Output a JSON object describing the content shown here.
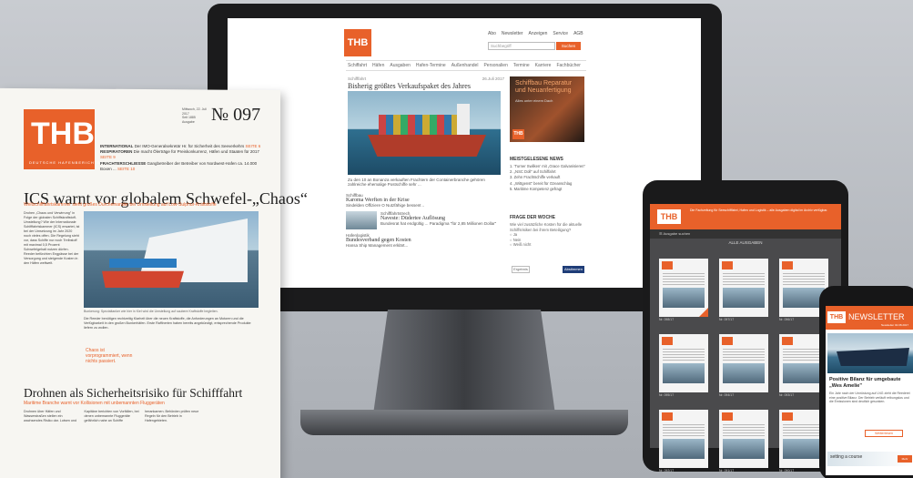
{
  "brand": {
    "accent": "#e8612a",
    "logo": "THB",
    "logo_sub": "DEUTSCHE HAFENBERICHTE"
  },
  "website": {
    "header_links": [
      "Abo",
      "Newsletter",
      "Anzeigen",
      "Service",
      "AGB"
    ],
    "search_placeholder": "Suchbegriff",
    "search_button": "Suchen",
    "nav": [
      "Schiffahrt",
      "Häfen",
      "Ausgaben",
      "Hafen-Termine",
      "Außenhandel",
      "Personalien",
      "Termine",
      "Karriere",
      "Fachbücher"
    ],
    "main_kicker": "Schifffahrt",
    "main_date": "26.Juli 2017",
    "main_title": "Bisherig größtes Verkaufspaket des Jahres",
    "main_caption": "Zu den 10 an Bonanza verkauften Frachtern der Containerbranche gehören zahlreiche ehemalige Postschiffe sehr ...",
    "ad_title": "Schiffbau Reparatur und Neuanfertigung",
    "ad_sub": "Alles unter einem Dach",
    "news_head": "MEISTGELESENE NEWS",
    "news_items": [
      "1. 'Turner Swilken' mit „Grace Galvanisieren\"",
      "2. „NSC Doll\" auf Schiffahrt",
      "3. Zehn Frachtschiffe verkauft",
      "4. „Wittgenst\" bereit für Ozeanschlag",
      "5. Maritime Kompetenz gefragt"
    ],
    "sub_kicker": "Schiffbau",
    "sub_title": "Karoma Werften in der Krise",
    "sub_text": "Sindelden Offiziere O Nutzfähige bessent ..",
    "list": [
      {
        "kicker": "Schifffahrtstrech",
        "title": "Naveste: Düdertee Auflösung",
        "text": "Bundesrat hat endgültig ... Paradigma \"für 2,85 Millionen Dollar\""
      },
      {
        "kicker": "Hafenlogistik",
        "title": "Bundesverband gegen Kosten",
        "text": "Hansa Ship Management erklärt..."
      }
    ],
    "poll_head": "FRAGE DER WOCHE",
    "poll_text": "Wie viel zusätzliche Kosten für die aktuelle Schiffsrisiken bei ihrem Beteiligung?",
    "poll_options": [
      "Ja",
      "Nein",
      "Weiß nicht"
    ],
    "poll_secondary_button": "Ergebnis",
    "poll_button": "Abstimmen"
  },
  "newspaper": {
    "issue_number": "№ 097",
    "date_lines": [
      "Mittwoch, 22. Juli 2017",
      "Seit 1885",
      "Ausgabe"
    ],
    "teasers": [
      {
        "label": "INTERNATIONAL",
        "text": "Der IMO-Generalsekretär Hr. für Sicherheit des Seeverkehrs",
        "ref": "SEITE 6"
      },
      {
        "label": "RESPIRATOREN",
        "text": "Die macht Ölerträge für Preiskonkurrenz, Häfen und Staaten für 2017",
        "ref": "SEITE 9"
      },
      {
        "label": "FRACHTERSCHLIESSE",
        "text": "Gangbetreiber der Betreiber von Nordwest-Hafen ca. 14.000 Boxen ...",
        "ref": "SEITE 10"
      }
    ],
    "headline": "ICS warnt vor globalem Schwefel-„Chaos“",
    "deck": "Weltschifffahrtskammer sieht großes Durcheinander bei Umstellung auf Low-Sulphur-Kraftstoffe",
    "column_text": "Drohen „Chaos und Verwirrung\" in Folge der globalen Schiffskraftstoff-Umstellung? Wie der Internationale Schifffahrtskammer (ICS) erwartet, ist bei der Umsetzung im Jahr 2020 noch vieles offen. Die Regelung sieht vor, dass Schiffe nur noch Treibstoff mit maximal 0,5 Prozent Schwefelgehalt nutzen dürfen. Reeder befürchten Engpässe bei der Versorgung und steigende Kosten in den Häfen weltweit.",
    "photo_caption": "Bunkerung: Spezialtanker wie hier in Kiel wird die Umstellung auf saubere Kraftstoffe begleiten.",
    "body_text": "Die Reeder benötigen rechtzeitig Klarheit über die neuen Kraftstoffe, die Anforderungen an Motoren und die Verfügbarkeit in den großen Bunkerhäfen. Erste Raffinerien haben bereits angekündigt, entsprechende Produkte liefern zu wollen.",
    "quote": "Chaos ist vorprogrammiert, wenn nichts passiert.",
    "headline2": "Drohnen als Sicherheitsrisiko für Schifffahrt",
    "deck2": "Maritime Branche warnt vor Kollisionen mit unbemannten Fluggeräten",
    "body2": "Drohnen über Häfen und Wasserstraßen stellen ein wachsendes Risiko dar. Lotsen und Kapitäne berichten von Vorfällen, bei denen unbemannte Fluggeräte gefährlich nahe an Schiffe herankamen. Behörden prüfen neue Regeln für den Betrieb in Hafengebieten."
  },
  "tablet": {
    "header_text": "Die Fachzeitung für Seeschifffahrt, Hafen und Logistik – alle Ausgaben digital im Archiv verfügbar.",
    "search_placeholder": "Ausgabe suchen",
    "section_title": "ALLE AUSGABEN",
    "issues": [
      "Nr. 098/17",
      "Nr. 097/17",
      "Nr. 096/17",
      "Nr. 095/17",
      "Nr. 094/17",
      "Nr. 093/17",
      "Nr. 092/17",
      "Nr. 091/17",
      "Nr. 090/17"
    ]
  },
  "phone": {
    "newsletter_label": "NEWSLETTER",
    "sub": "Newsletter 02.08.2017",
    "title": "Positive Bilanz für umgebaute „Wes Amelie\"",
    "text": "Ein Jahr nach der Umrüstung auf LNG zieht die Reederei eine positive Bilanz. Der Betrieb verläuft reibungslos und die Emissionen sind deutlich gesunken.",
    "button": "Weiterlesen",
    "banner_text": "setting a course",
    "banner_button": "Mehr"
  }
}
